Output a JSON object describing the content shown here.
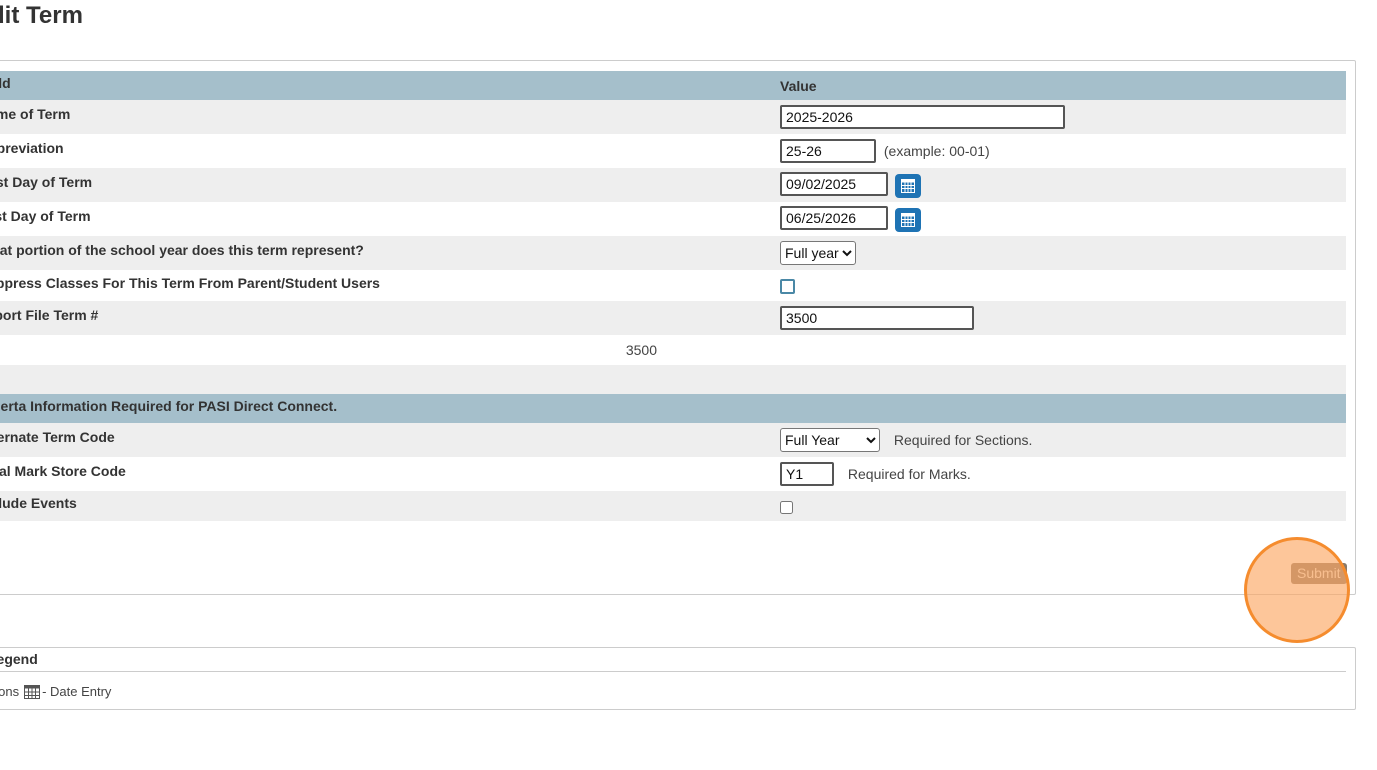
{
  "page": {
    "title": "Edit Term"
  },
  "table": {
    "header": {
      "field": "Field",
      "value": "Value"
    },
    "rows": {
      "name": {
        "label": "Name of Term",
        "value": "2025-2026"
      },
      "abbreviation": {
        "label": "Abbreviation",
        "value": "25-26",
        "hint": "(example: 00-01)"
      },
      "first_day": {
        "label": "First Day of Term",
        "value": "09/02/2025"
      },
      "last_day": {
        "label": "Last Day of Term",
        "value": "06/25/2026"
      },
      "portion": {
        "label": "What portion of the school year does this term represent?",
        "selected": "Full year"
      },
      "suppress": {
        "label": "Suppress Classes For This Term From Parent/Student Users",
        "checked": false
      },
      "import_term": {
        "label": "Import File Term #",
        "value": "3500"
      },
      "term_id": {
        "value": "3500"
      }
    },
    "alberta": {
      "header": "Alberta Information  Required for PASI Direct Connect.",
      "alt_term": {
        "label": "Alternate Term Code",
        "selected": "Full Year",
        "hint": "Required for Sections."
      },
      "final_mark": {
        "label": "Final Mark Store Code",
        "value": "Y1",
        "hint": "Required for Marks."
      },
      "include_events": {
        "label": "Include Events",
        "checked": false
      }
    }
  },
  "actions": {
    "submit": "Submit"
  },
  "legend": {
    "title": "Legend",
    "icons_label": "Icons",
    "date_entry": "- Date Entry"
  },
  "colors": {
    "header_bg": "#a5bfcb",
    "calendar_button": "#1e73b4",
    "submit_bg": "#897a6a",
    "click_halo": "#f58c2e"
  },
  "icons": [
    "calendar-icon",
    "click-indicator"
  ]
}
